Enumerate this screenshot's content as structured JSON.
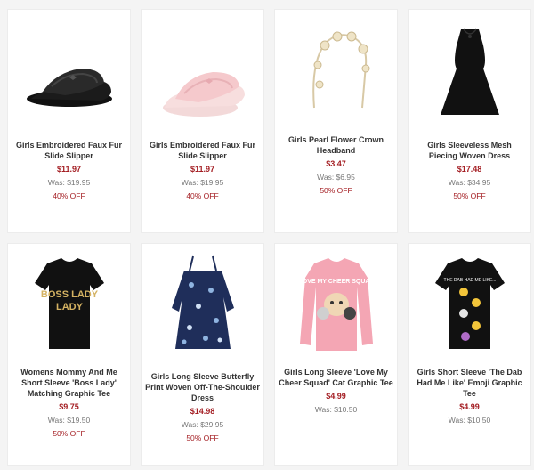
{
  "products": [
    {
      "name": "Girls Embroidered Faux Fur Slide Slipper",
      "price": "$11.97",
      "was": "Was: $19.95",
      "off": "40% OFF",
      "icon": "black-slipper-image"
    },
    {
      "name": "Girls Embroidered Faux Fur Slide Slipper",
      "price": "$11.97",
      "was": "Was: $19.95",
      "off": "40% OFF",
      "icon": "pink-slipper-image"
    },
    {
      "name": "Girls Pearl Flower Crown Headband",
      "price": "$3.47",
      "was": "Was: $6.95",
      "off": "50% OFF",
      "icon": "headband-image"
    },
    {
      "name": "Girls Sleeveless Mesh Piecing Woven Dress",
      "price": "$17.48",
      "was": "Was: $34.95",
      "off": "50% OFF",
      "icon": "black-dress-image"
    },
    {
      "name": "Womens Mommy And Me Short Sleeve 'Boss Lady' Matching Graphic Tee",
      "price": "$9.75",
      "was": "Was: $19.50",
      "off": "50% OFF",
      "icon": "boss-lady-tee-image",
      "print": "BOSS LADY"
    },
    {
      "name": "Girls Long Sleeve Butterfly Print Woven Off-The-Shoulder Dress",
      "price": "$14.98",
      "was": "Was: $29.95",
      "off": "50% OFF",
      "icon": "butterfly-dress-image"
    },
    {
      "name": "Girls Long Sleeve 'Love My Cheer Squad' Cat Graphic Tee",
      "price": "$4.99",
      "was": "Was: $10.50",
      "off": "",
      "icon": "cat-tee-image",
      "print": "LOVE MY CHEER SQUAD"
    },
    {
      "name": "Girls Short Sleeve 'The Dab Had Me Like' Emoji Graphic Tee",
      "price": "$4.99",
      "was": "Was: $10.50",
      "off": "",
      "icon": "emoji-tee-image",
      "print": "THE DAB HAD ME LIKE..."
    }
  ],
  "colors": {
    "price": "#a41e23",
    "was": "#777777",
    "name": "#333333"
  }
}
